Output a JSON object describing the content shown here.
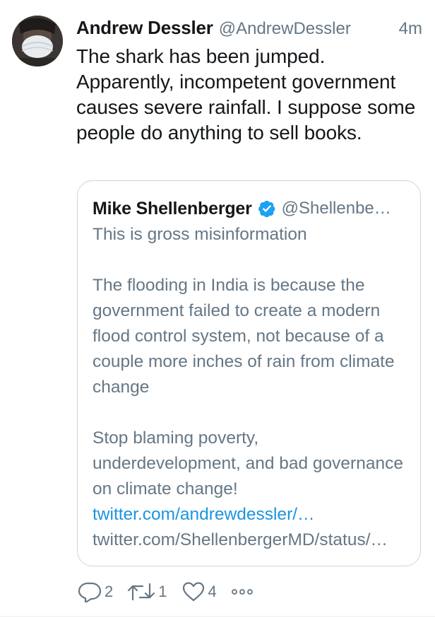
{
  "tweet": {
    "author_name": "Andrew Dessler",
    "author_handle": "@AndrewDessler",
    "timestamp": "4m",
    "text": "The shark has been jumped. Apparently, incompetent government causes severe rainfall. I suppose some people do anything to sell books."
  },
  "quoted_tweet": {
    "author_name": "Mike Shellenberger",
    "author_handle": "@Shellenbe…",
    "verified": true,
    "paragraphs": [
      "This is gross misinformation",
      "The flooding in India is because the government failed to create a modern flood control system, not because of a couple more inches of rain from climate change",
      "Stop blaming poverty, underdevelopment, and bad governance on climate change!"
    ],
    "link_1": "twitter.com/andrewdessler/…",
    "link_2": "twitter.com/ShellenbergerMD/status/…"
  },
  "actions": {
    "reply_count": "2",
    "retweet_count": "1",
    "like_count": "4"
  },
  "colors": {
    "primary_text": "#14171a",
    "secondary_text": "#657786",
    "link": "#1b95e0",
    "border": "#ccd6dd",
    "verified_badge": "#1da1f2"
  },
  "icons": {
    "reply": "reply-icon",
    "retweet": "retweet-icon",
    "like": "heart-icon",
    "more": "more-icon",
    "verified": "verified-badge-icon"
  }
}
